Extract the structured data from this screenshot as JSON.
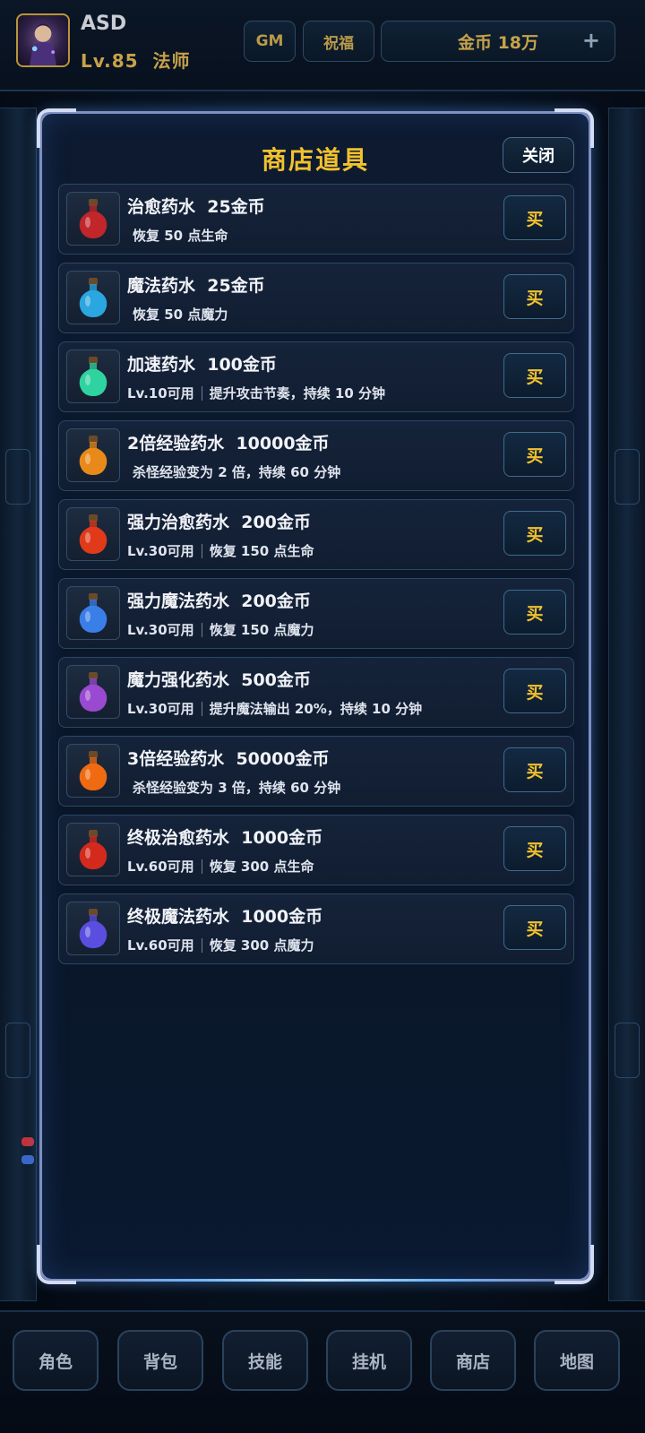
{
  "player": {
    "name": "ASD",
    "level_class": "Lv.85  法师"
  },
  "header": {
    "gm_label": "GM",
    "bless_label": "祝福",
    "gold_label": "金币 18万",
    "plus_label": "+"
  },
  "shop": {
    "title": "商店道具",
    "close_label": "关闭",
    "buy_label": "买",
    "items": [
      {
        "title": "治愈药水  25金币",
        "requirement": "",
        "desc": "恢复 50 点生命",
        "icon": "red-potion-icon",
        "color": "#c0262a"
      },
      {
        "title": "魔法药水  25金币",
        "requirement": "",
        "desc": "恢复 50 点魔力",
        "icon": "blue-potion-icon",
        "color": "#2aa6e0"
      },
      {
        "title": "加速药水  100金币",
        "requirement": "Lv.10可用",
        "desc": "提升攻击节奏，持续 10 分钟",
        "icon": "green-speed-potion-icon",
        "color": "#2fd3a0"
      },
      {
        "title": "2倍经验药水  10000金币",
        "requirement": "",
        "desc": "杀怪经验变为 2 倍，持续 60 分钟",
        "icon": "orange-potion-icon",
        "color": "#e88a1a"
      },
      {
        "title": "强力治愈药水  200金币",
        "requirement": "Lv.30可用",
        "desc": "恢复 150 点生命",
        "icon": "strong-red-potion-icon",
        "color": "#e03a1a"
      },
      {
        "title": "强力魔法药水  200金币",
        "requirement": "Lv.30可用",
        "desc": "恢复 150 点魔力",
        "icon": "strong-blue-potion-icon",
        "color": "#3a7ee8"
      },
      {
        "title": "魔力强化药水  500金币",
        "requirement": "Lv.30可用",
        "desc": "提升魔法输出 20%，持续 10 分钟",
        "icon": "purple-potion-icon",
        "color": "#9a4ad0"
      },
      {
        "title": "3倍经验药水  50000金币",
        "requirement": "",
        "desc": "杀怪经验变为 3 倍，持续 60 分钟",
        "icon": "fire-potion-icon",
        "color": "#f06a12"
      },
      {
        "title": "终极治愈药水  1000金币",
        "requirement": "Lv.60可用",
        "desc": "恢复 300 点生命",
        "icon": "ultimate-red-potion-icon",
        "color": "#d42a1e"
      },
      {
        "title": "终极魔法药水  1000金币",
        "requirement": "Lv.60可用",
        "desc": "恢复 300 点魔力",
        "icon": "ultimate-blue-potion-icon",
        "color": "#5a4ee0"
      }
    ]
  },
  "nav": {
    "items": [
      "角色",
      "背包",
      "技能",
      "挂机",
      "商店",
      "地图"
    ]
  }
}
